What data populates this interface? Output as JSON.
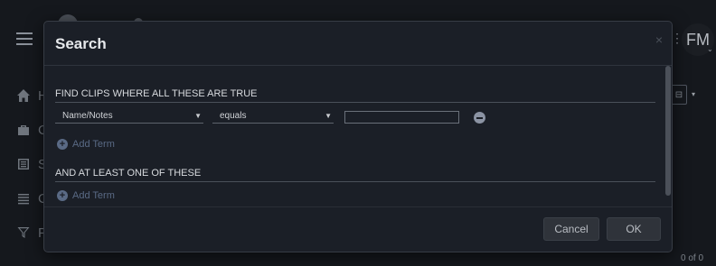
{
  "background": {
    "avatar_initials": "FM",
    "count_text": "0 of 0",
    "ellipsis": "⋮",
    "side_items": [
      {
        "icon": "home-icon",
        "label": "H"
      },
      {
        "icon": "briefcase-icon",
        "label": "C"
      },
      {
        "icon": "list-alt-icon",
        "label": "S"
      },
      {
        "icon": "list-icon",
        "label": "C"
      },
      {
        "icon": "filter-icon",
        "label": "F"
      }
    ]
  },
  "dialog": {
    "title": "Search",
    "close_label": "×",
    "all_section": {
      "title": "FIND CLIPS WHERE ALL THESE ARE TRUE",
      "term": {
        "field": "Name/Notes",
        "operator": "equals",
        "value": ""
      },
      "add_term_label": "Add Term"
    },
    "any_section": {
      "title": "AND AT LEAST ONE OF THESE",
      "add_term_label": "Add Term"
    },
    "footer": {
      "cancel_label": "Cancel",
      "ok_label": "OK"
    }
  }
}
